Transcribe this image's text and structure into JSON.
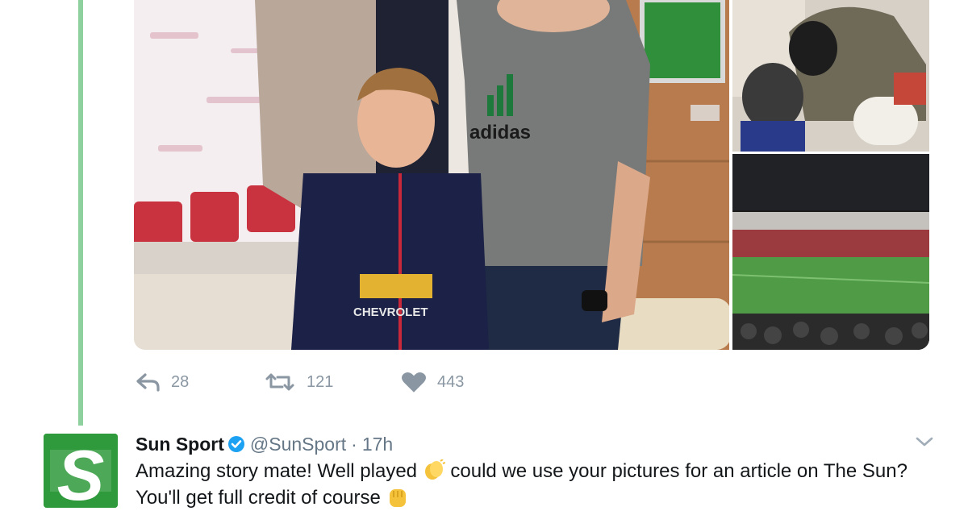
{
  "colors": {
    "thread_line": "#8fd19e",
    "action_gray": "#8a97a3",
    "verified_blue": "#1da1f2",
    "brand_green": "#2e9a3b",
    "text_primary": "#14171a",
    "text_secondary": "#657786"
  },
  "photos": {
    "main": {
      "shirt_sponsor": "CHEVROLET",
      "tshirt_brand": "adidas"
    }
  },
  "actions": {
    "reply": {
      "icon": "reply-icon",
      "count": "28"
    },
    "retweet": {
      "icon": "retweet-icon",
      "count": "121"
    },
    "like": {
      "icon": "heart-icon",
      "count": "443"
    }
  },
  "reply_tweet": {
    "avatar_letter": "S",
    "display_name": "Sun Sport",
    "verified_icon": "verified-badge-icon",
    "handle": "@SunSport",
    "separator": "·",
    "time": "17h",
    "caret_icon": "chevron-down-icon",
    "text_part1": "Amazing story mate! Well played",
    "text_part2": "could we use your pictures for an article on The Sun? You'll get full credit of course",
    "emoji_1": "clapping-hands-emoji",
    "emoji_2": "raised-fist-emoji"
  }
}
